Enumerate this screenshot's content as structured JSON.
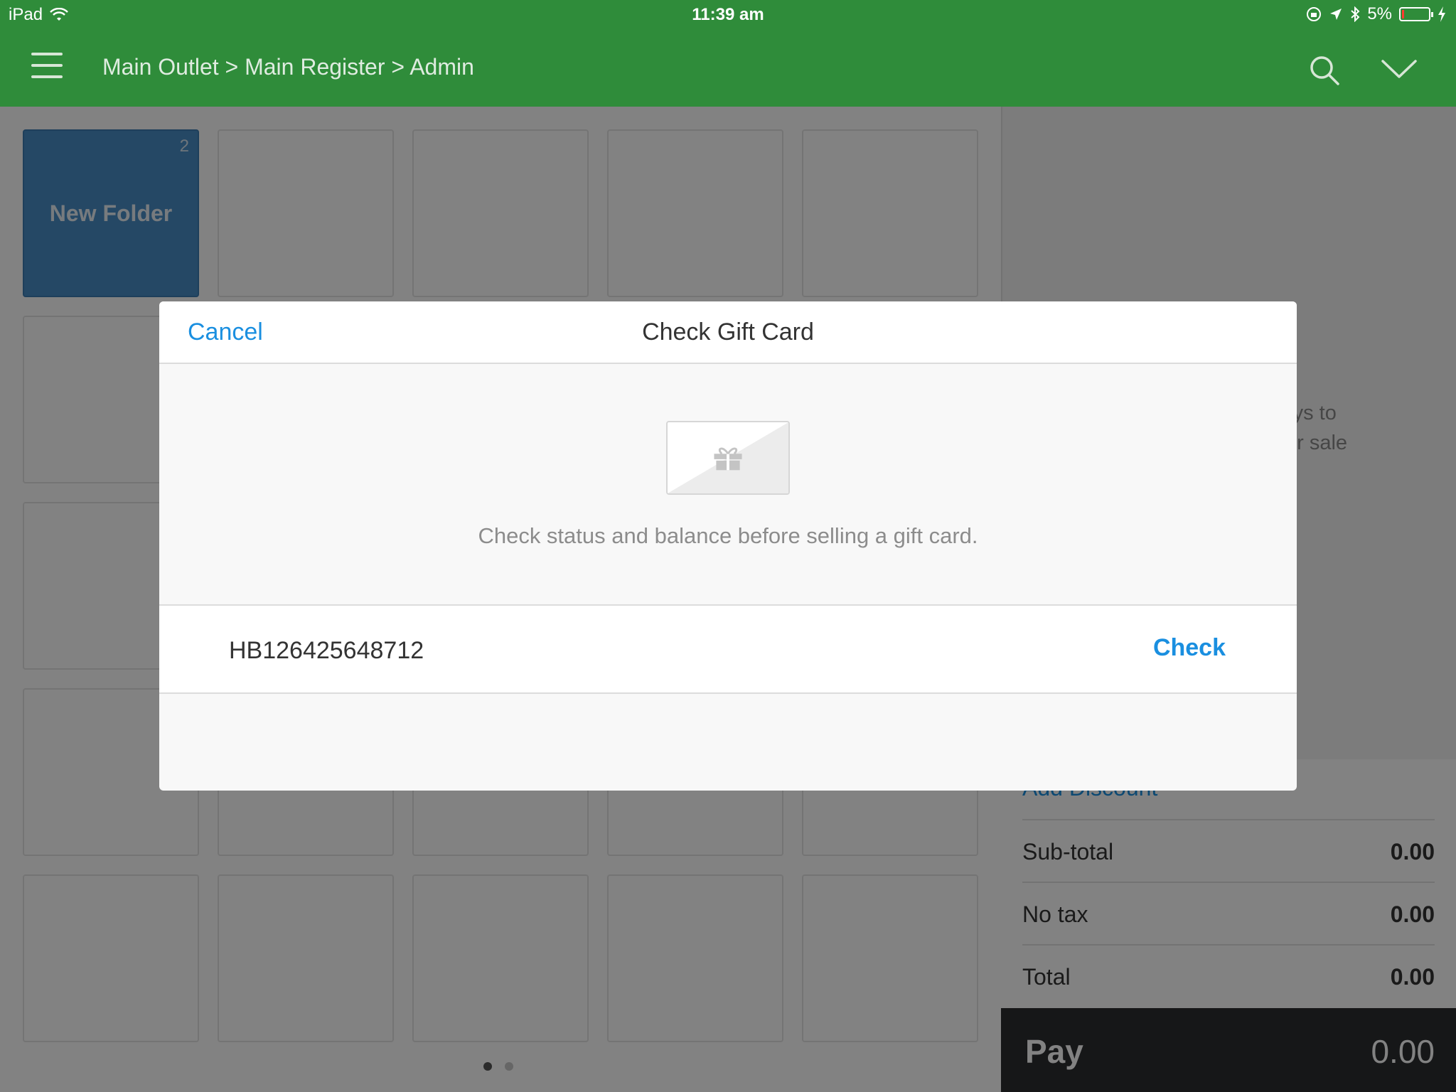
{
  "status_bar": {
    "device": "iPad",
    "time": "11:39 am",
    "battery": "5%",
    "icons": [
      "wifi-icon",
      "rotation-lock-icon",
      "location-icon",
      "bluetooth-icon",
      "battery-icon",
      "charging-icon"
    ]
  },
  "nav": {
    "breadcrumb": "Main Outlet > Main Register > Admin",
    "icons": [
      "menu-icon",
      "search-icon",
      "chevron-down-icon"
    ]
  },
  "grid": {
    "folder": {
      "label": "New Folder",
      "count": "2"
    }
  },
  "sale_panel": {
    "empty_hint_line1": "keys to",
    "empty_hint_line2": "ur sale",
    "add_discount": "Add Discount",
    "subtotal_label": "Sub-total",
    "subtotal_value": "0.00",
    "tax_label": "No tax",
    "tax_value": "0.00",
    "total_label": "Total",
    "total_value": "0.00",
    "pay_label": "Pay",
    "pay_value": "0.00"
  },
  "modal": {
    "cancel_label": "Cancel",
    "title": "Check Gift Card",
    "description": "Check status and balance before selling a gift card.",
    "code_value": "HB126425648712",
    "check_label": "Check",
    "icon": "gift-card-icon"
  },
  "colors": {
    "nav_green": "#2f8c3a",
    "link_blue": "#1a8fe0",
    "folder_blue": "#4a8ec7",
    "pay_bar": "#2b2d30"
  }
}
